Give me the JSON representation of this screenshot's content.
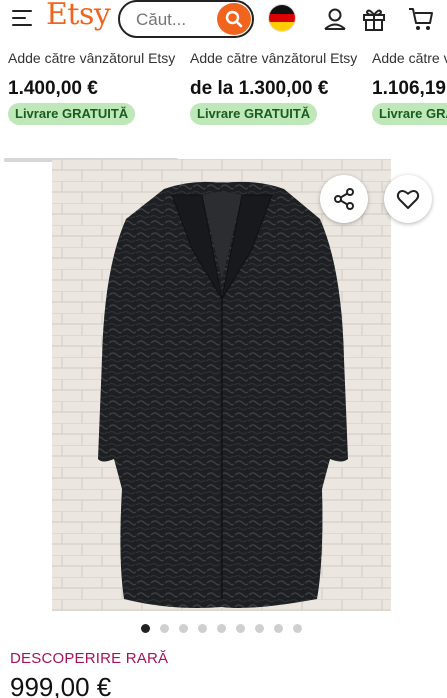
{
  "header": {
    "logo": "Etsy",
    "search_placeholder": "Căut...",
    "icons": [
      "menu-icon",
      "search-icon",
      "flag-icon",
      "user-icon",
      "gift-icon",
      "cart-icon"
    ]
  },
  "recommendations": [
    {
      "title": "Adde către vânzătorul Etsy",
      "price": "1.400,00 €",
      "badge": "Livrare GRATUITĂ"
    },
    {
      "title": "Adde către vânzătorul Etsy",
      "price": "de la 1.300,00 €",
      "badge": "Livrare GRATUITĂ"
    },
    {
      "title": "Adde către vânzătorul Etsy",
      "price": "1.106,19",
      "badge": "Livrare GRATUITĂ"
    }
  ],
  "product": {
    "image_icons": [
      "share-icon",
      "heart-icon"
    ],
    "carousel_dots": 9,
    "active_dot": 0,
    "rare_label": "DESCOPERIRE RARĂ",
    "price": "999,00 €"
  },
  "colors": {
    "brand": "#f1641e",
    "badge_bg": "#bfe8b8",
    "badge_text": "#1a5b1f",
    "rare": "#a6115c"
  }
}
